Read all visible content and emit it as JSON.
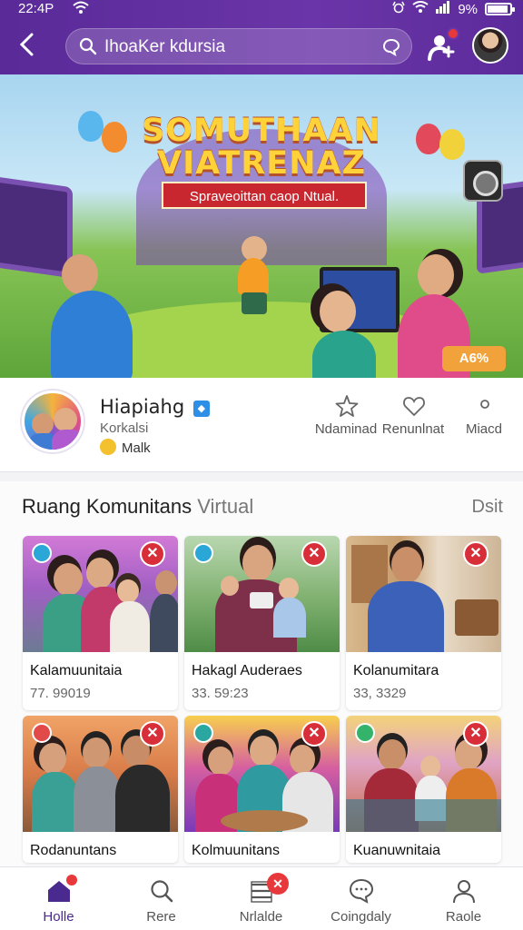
{
  "status_bar": {
    "time": "22:4P",
    "battery": "9%"
  },
  "header": {
    "search_query": "IhoaKer kdursia"
  },
  "banner": {
    "title_line1": "SOMUTHAAN",
    "title_line2": "VIATRENAZ",
    "ribbon": "Spraveoittan caop Ntual.",
    "discount": "A6%"
  },
  "profile": {
    "name": "Hiapiahg",
    "subtitle": "Korkalsi",
    "mood": "Malk",
    "actions": [
      {
        "label": "Ndaminad",
        "icon": "star-icon"
      },
      {
        "label": "Renunlnat",
        "icon": "heart-icon"
      },
      {
        "label": "Miacd",
        "icon": "dot-icon"
      }
    ]
  },
  "section": {
    "title_main": "Ruang Komunitans",
    "title_muted": "Virtual",
    "more": "Dsit",
    "cards": [
      {
        "title": "Kalamuunitaia",
        "count": "77. 99019"
      },
      {
        "title": "Hakagl Auderaes",
        "count": "33. 59:23"
      },
      {
        "title": "Kolanumitara",
        "count": "33, 3329"
      },
      {
        "title": "Rodanuntans",
        "count": ""
      },
      {
        "title": "Kolmuunitans",
        "count": ""
      },
      {
        "title": "Kuanuwnitaia",
        "count": ""
      }
    ]
  },
  "bottom_nav": [
    {
      "label": "Holle",
      "icon": "home-icon",
      "active": true
    },
    {
      "label": "Rere",
      "icon": "search-icon"
    },
    {
      "label": "Nrlalde",
      "icon": "list-icon"
    },
    {
      "label": "Coingdaly",
      "icon": "chat-icon"
    },
    {
      "label": "Raole",
      "icon": "profile-icon"
    }
  ],
  "colors": {
    "brand": "#5a2a98",
    "accent": "#d82e3a",
    "banner_title": "#ffd23a"
  }
}
